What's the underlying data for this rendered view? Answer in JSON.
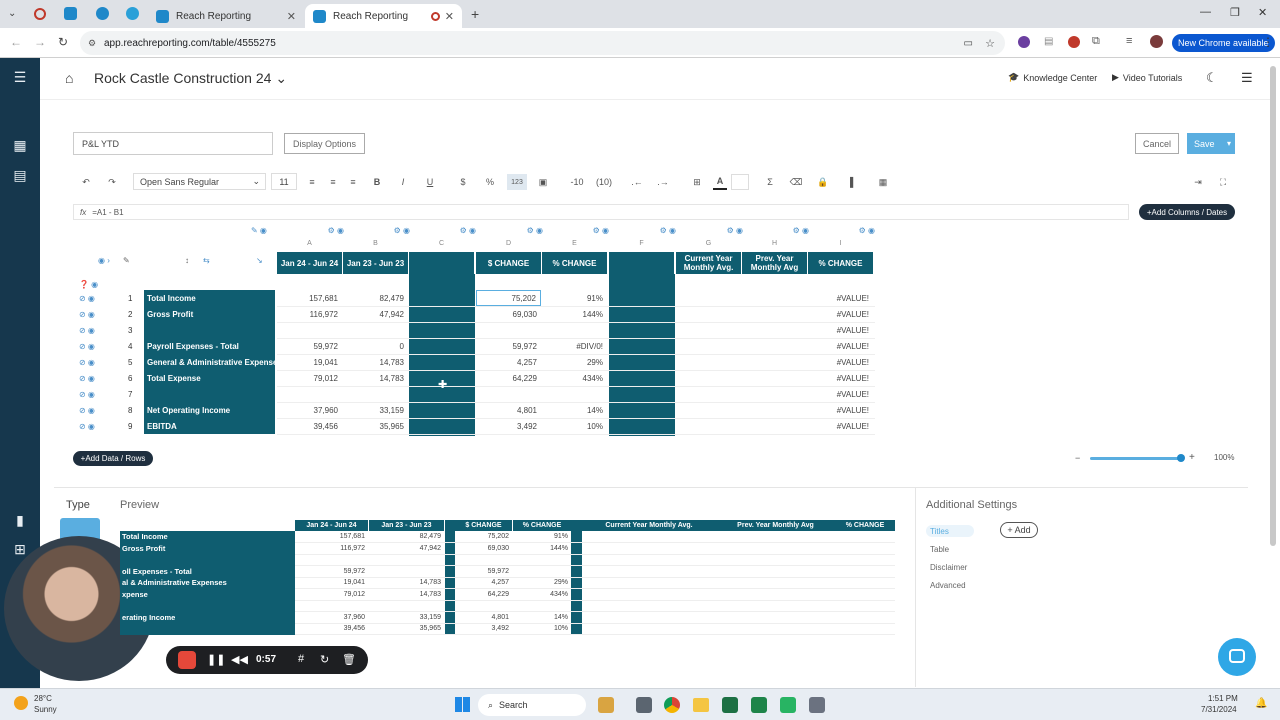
{
  "browser": {
    "tabs": [
      {
        "label": "Reach Reporting",
        "active": false
      },
      {
        "label": "Reach Reporting",
        "active": true
      }
    ],
    "url": "app.reachreporting.com/table/4555275",
    "new_chrome": "New Chrome available"
  },
  "app": {
    "title": "Rock Castle Construction 24",
    "knowledge_center": "Knowledge Center",
    "video_tutorials": "Video Tutorials"
  },
  "editor": {
    "table_name": "P&L YTD",
    "display_options": "Display Options",
    "cancel": "Cancel",
    "save": "Save",
    "font_name": "Open Sans Regular",
    "font_size": "11",
    "decimal_minus": "-10",
    "decimal_paren": "(10)",
    "formula": "=A1 - B1",
    "add_columns": "Add Columns / Dates",
    "add_rows": "Add Data / Rows",
    "zoom": "100%"
  },
  "grid": {
    "col_letters": [
      "A",
      "B",
      "C",
      "D",
      "E",
      "F",
      "G",
      "H",
      "I"
    ],
    "headers": [
      "Jan 24 - Jun 24",
      "Jan 23 - Jun 23",
      "",
      "$ CHANGE",
      "% CHANGE",
      "",
      "Current Year Monthly Avg.",
      "Prev. Year Monthly Avg",
      "% CHANGE"
    ],
    "rows": [
      {
        "num": "1",
        "label": "Total Income",
        "a": "157,681",
        "b": "82,479",
        "d": "75,202",
        "e": "91%",
        "i": "#VALUE!"
      },
      {
        "num": "2",
        "label": "Gross Profit",
        "a": "116,972",
        "b": "47,942",
        "d": "69,030",
        "e": "144%",
        "i": "#VALUE!"
      },
      {
        "num": "3",
        "label": "",
        "a": "",
        "b": "",
        "d": "",
        "e": "",
        "i": "#VALUE!"
      },
      {
        "num": "4",
        "label": "Payroll Expenses - Total",
        "a": "59,972",
        "b": "0",
        "d": "59,972",
        "e": "#DIV/0!",
        "i": "#VALUE!"
      },
      {
        "num": "5",
        "label": "General & Administrative Expenses",
        "a": "19,041",
        "b": "14,783",
        "d": "4,257",
        "e": "29%",
        "i": "#VALUE!"
      },
      {
        "num": "6",
        "label": "Total Expense",
        "a": "79,012",
        "b": "14,783",
        "d": "64,229",
        "e": "434%",
        "i": "#VALUE!"
      },
      {
        "num": "7",
        "label": "",
        "a": "",
        "b": "",
        "d": "",
        "e": "",
        "i": "#VALUE!"
      },
      {
        "num": "8",
        "label": "Net Operating Income",
        "a": "37,960",
        "b": "33,159",
        "d": "4,801",
        "e": "14%",
        "i": "#VALUE!"
      },
      {
        "num": "9",
        "label": "EBITDA",
        "a": "39,456",
        "b": "35,965",
        "d": "3,492",
        "e": "10%",
        "i": "#VALUE!"
      }
    ]
  },
  "bottom": {
    "type_label": "Type",
    "preview_label": "Preview",
    "additional_settings": "Additional Settings",
    "add": "+ Add",
    "settings_items": [
      "Titles",
      "Table",
      "Disclaimer",
      "Advanced"
    ],
    "preview_headers": [
      "Jan 24 - Jun 24",
      "Jan 23 - Jun 23",
      "$ CHANGE",
      "% CHANGE",
      "Current Year Monthly Avg.",
      "Prev. Year Monthly Avg",
      "% CHANGE"
    ],
    "preview_rows": [
      {
        "label": "Total Income",
        "a": "157,681",
        "b": "82,479",
        "d": "75,202",
        "e": "91%"
      },
      {
        "label": "Gross Profit",
        "a": "116,972",
        "b": "47,942",
        "d": "69,030",
        "e": "144%"
      },
      {
        "label": "",
        "a": "",
        "b": "",
        "d": "",
        "e": ""
      },
      {
        "label": "oll Expenses - Total",
        "a": "59,972",
        "b": "",
        "d": "59,972",
        "e": ""
      },
      {
        "label": "al & Administrative Expenses",
        "a": "19,041",
        "b": "14,783",
        "d": "4,257",
        "e": "29%"
      },
      {
        "label": "xpense",
        "a": "79,012",
        "b": "14,783",
        "d": "64,229",
        "e": "434%"
      },
      {
        "label": "",
        "a": "",
        "b": "",
        "d": "",
        "e": ""
      },
      {
        "label": "erating Income",
        "a": "37,960",
        "b": "33,159",
        "d": "4,801",
        "e": "14%"
      },
      {
        "label": "",
        "a": "39,456",
        "b": "35,965",
        "d": "3,492",
        "e": "10%"
      }
    ]
  },
  "recorder": {
    "time": "0:57"
  },
  "taskbar": {
    "weather_temp": "28°C",
    "weather_desc": "Sunny",
    "search": "Search",
    "time": "1:51 PM",
    "date": "7/31/2024"
  },
  "colors": {
    "teal": "#0f5d70",
    "accent": "#5aaee0"
  }
}
